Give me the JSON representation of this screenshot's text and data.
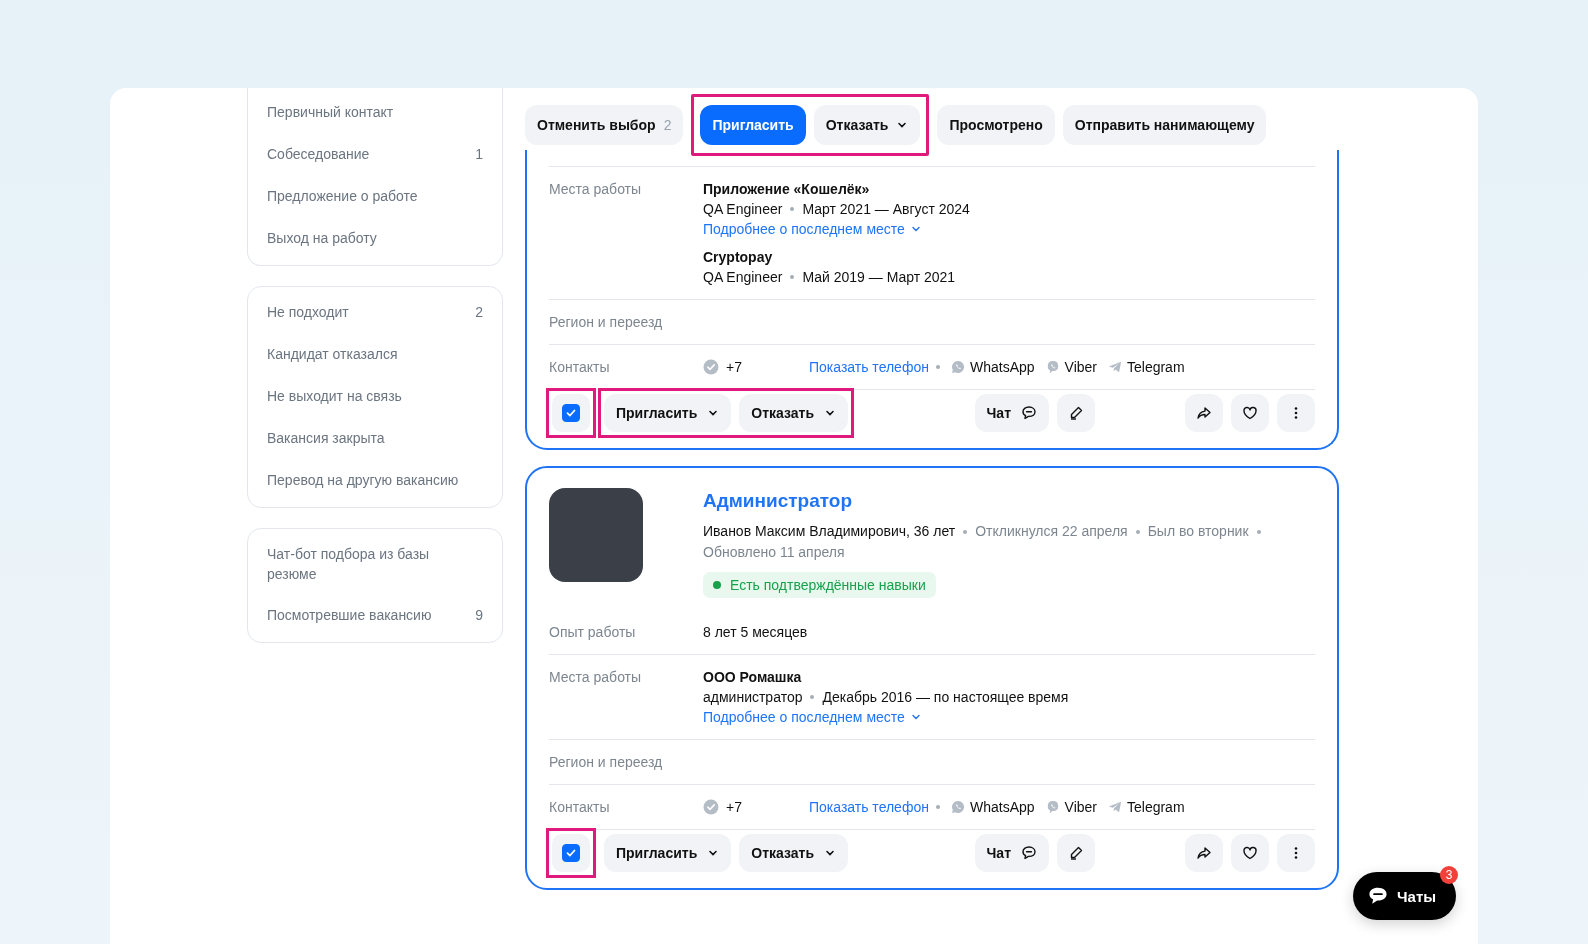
{
  "sidebar": {
    "groups": [
      {
        "cut_top": true,
        "items": [
          {
            "label": "Первичный контакт"
          },
          {
            "label": "Собеседование",
            "count": "1"
          },
          {
            "label": "Предложение о работе"
          },
          {
            "label": "Выход на работу"
          }
        ]
      },
      {
        "cut_top": false,
        "items": [
          {
            "label": "Не подходит",
            "count": "2"
          },
          {
            "label": "Кандидат отказался"
          },
          {
            "label": "Не выходит на связь"
          },
          {
            "label": "Вакансия закрыта"
          },
          {
            "label": "Перевод на другую вакансию"
          }
        ]
      },
      {
        "cut_top": false,
        "items": [
          {
            "label": "Чат-бот подбора из базы резюме"
          },
          {
            "label": "Посмотревшие вакансию",
            "count": "9"
          }
        ]
      }
    ]
  },
  "toolbar": {
    "groups": [
      {
        "highlighted": false,
        "buttons": [
          {
            "kind": "count",
            "label": "Отменить выбор",
            "count": "2"
          }
        ]
      },
      {
        "highlighted": true,
        "buttons": [
          {
            "kind": "primary",
            "label": "Пригласить"
          },
          {
            "kind": "dropdown",
            "label": "Отказать"
          }
        ]
      },
      {
        "highlighted": false,
        "buttons": [
          {
            "kind": "plain",
            "label": "Просмотрено"
          },
          {
            "kind": "plain",
            "label": "Отправить нанимающему"
          }
        ]
      }
    ]
  },
  "cards": [
    {
      "cut_top": true,
      "selected": true,
      "checkbox_highlighted": true,
      "buttons_highlighted": true,
      "rows": [
        {
          "kind": "jobs",
          "label": "Места работы",
          "jobs": [
            {
              "company": "Приложение «Кошелёк»",
              "position": "QA Engineer",
              "period": "Март 2021 — Август 2024",
              "more": "Подробнее о последнем месте"
            },
            {
              "company": "Cryptopay",
              "position": "QA Engineer",
              "period": "Май 2019 — Март 2021"
            }
          ]
        },
        {
          "kind": "empty",
          "label": "Регион и переезд"
        },
        {
          "kind": "contacts",
          "label": "Контакты",
          "phone": "+7",
          "show_phone": "Показать телефон",
          "messengers": [
            {
              "kind": "whatsapp",
              "label": "WhatsApp"
            },
            {
              "kind": "viber",
              "label": "Viber"
            },
            {
              "kind": "telegram",
              "label": "Telegram"
            }
          ]
        }
      ],
      "actions": {
        "invite": "Пригласить",
        "reject": "Отказать",
        "chat": "Чат"
      }
    },
    {
      "cut_top": false,
      "selected": true,
      "checkbox_highlighted": true,
      "buttons_highlighted": false,
      "title": "Администратор",
      "person": "Иванов Максим Владимирович, 36 лет",
      "meta": [
        "Откликнулся 22 апреля",
        "Был во вторник",
        "Обновлено 11 апреля"
      ],
      "badge": "Есть подтверждённые навыки",
      "rows": [
        {
          "kind": "text",
          "label": "Опыт работы",
          "value": "8 лет 5 месяцев"
        },
        {
          "kind": "jobs",
          "label": "Места работы",
          "jobs": [
            {
              "company": "ООО Ромашка",
              "position": "администратор",
              "period": "Декабрь 2016 — по настоящее время",
              "more": "Подробнее о последнем месте"
            }
          ]
        },
        {
          "kind": "empty",
          "label": "Регион и переезд"
        },
        {
          "kind": "contacts",
          "label": "Контакты",
          "phone": "+7",
          "show_phone": "Показать телефон",
          "messengers": [
            {
              "kind": "whatsapp",
              "label": "WhatsApp"
            },
            {
              "kind": "viber",
              "label": "Viber"
            },
            {
              "kind": "telegram",
              "label": "Telegram"
            }
          ]
        }
      ],
      "actions": {
        "invite": "Пригласить",
        "reject": "Отказать",
        "chat": "Чат"
      }
    }
  ],
  "chats": {
    "label": "Чаты",
    "badge": "3"
  }
}
